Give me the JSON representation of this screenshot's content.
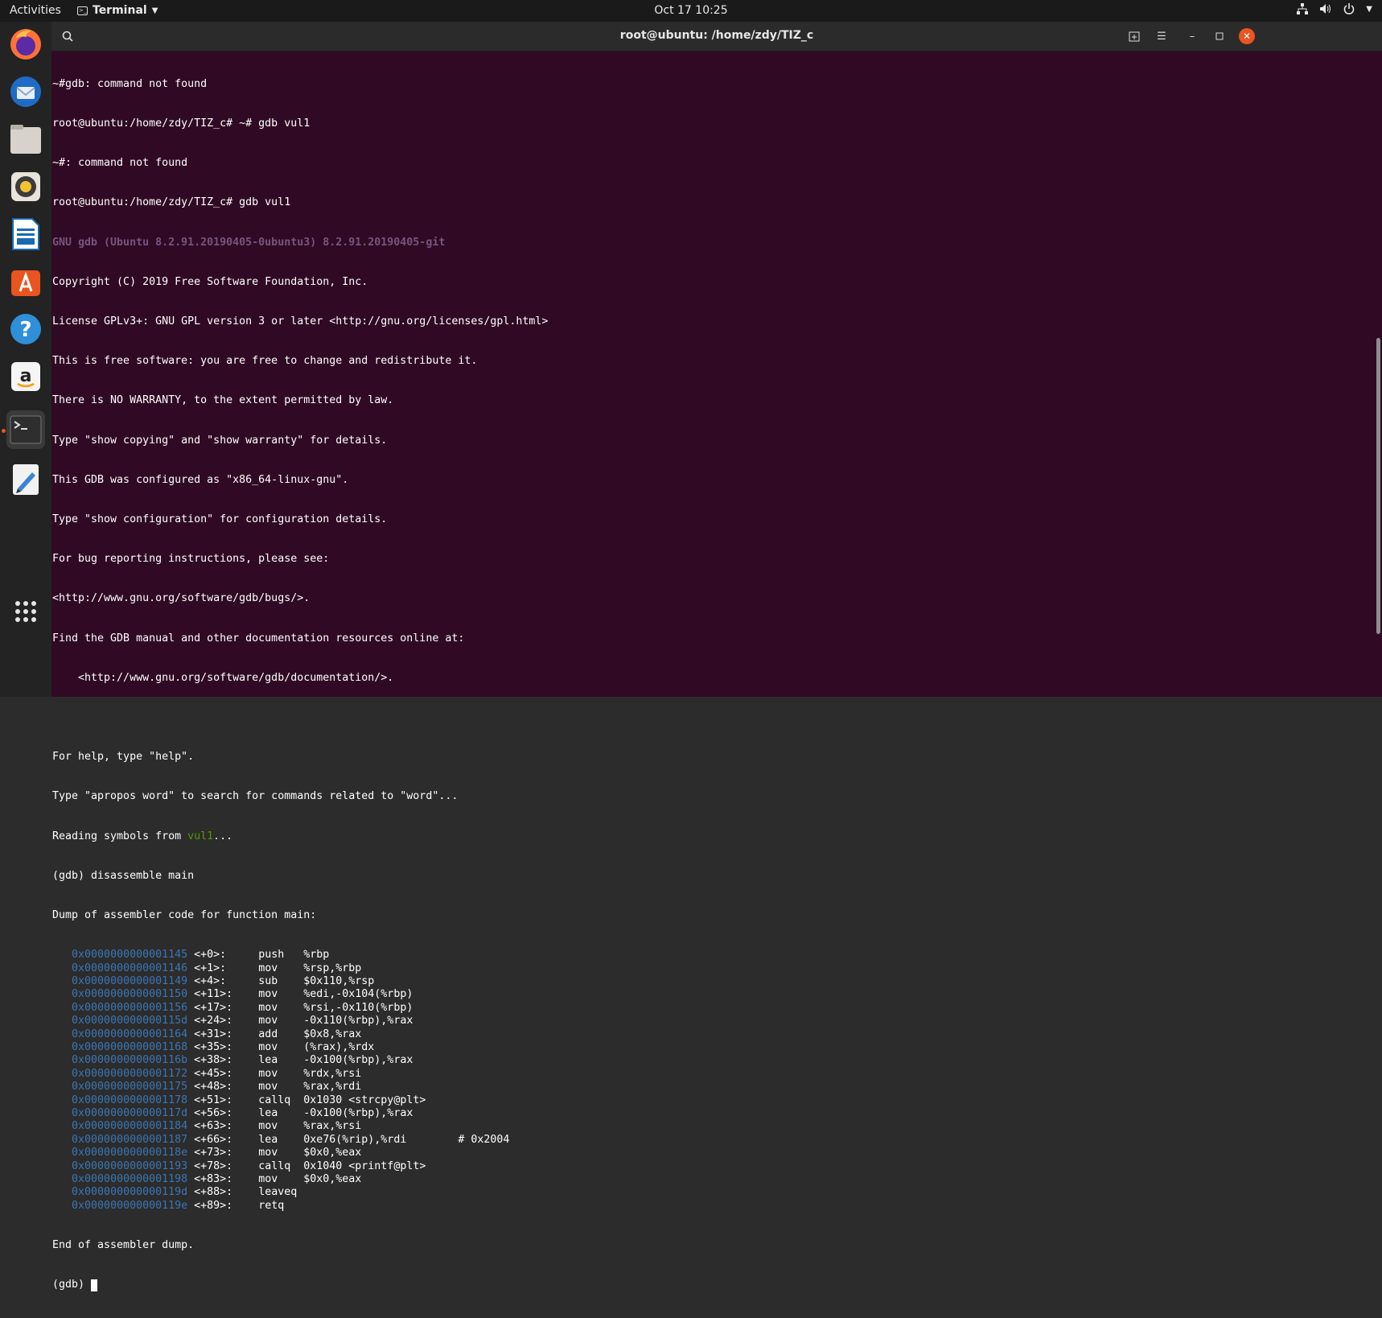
{
  "topbar": {
    "activities": "Activities",
    "app_name": "Terminal",
    "clock": "Oct 17  10:25"
  },
  "dock": {
    "items": [
      "firefox-icon",
      "thunderbird-icon",
      "files-icon",
      "rhythmbox-icon",
      "libreoffice-writer-icon",
      "software-center-icon",
      "help-icon",
      "amazon-icon",
      "terminal-icon",
      "text-editor-icon"
    ]
  },
  "window": {
    "title": "root@ubuntu: /home/zdy/TIZ_c"
  },
  "terminal": {
    "lines": [
      "~#gdb: command not found",
      "root@ubuntu:/home/zdy/TIZ_c# ~# gdb vul1",
      "~#: command not found",
      "root@ubuntu:/home/zdy/TIZ_c# gdb vul1",
      "GNU gdb (Ubuntu 8.2.91.20190405-0ubuntu3) 8.2.91.20190405-git",
      "Copyright (C) 2019 Free Software Foundation, Inc.",
      "License GPLv3+: GNU GPL version 3 or later <http://gnu.org/licenses/gpl.html>",
      "This is free software: you are free to change and redistribute it.",
      "There is NO WARRANTY, to the extent permitted by law.",
      "Type \"show copying\" and \"show warranty\" for details.",
      "This GDB was configured as \"x86_64-linux-gnu\".",
      "Type \"show configuration\" for configuration details.",
      "For bug reporting instructions, please see:",
      "<http://www.gnu.org/software/gdb/bugs/>.",
      "Find the GDB manual and other documentation resources online at:",
      "    <http://www.gnu.org/software/gdb/documentation/>.",
      "",
      "For help, type \"help\".",
      "Type \"apropos word\" to search for commands related to \"word\"...",
      "Reading symbols from ",
      "(gdb) disassemble main",
      "Dump of assembler code for function main:"
    ],
    "reading_file": "vul1",
    "reading_suffix": "...",
    "asm": [
      {
        "addr": "0x0000000000001145",
        "rest": " <+0>:     push   %rbp"
      },
      {
        "addr": "0x0000000000001146",
        "rest": " <+1>:     mov    %rsp,%rbp"
      },
      {
        "addr": "0x0000000000001149",
        "rest": " <+4>:     sub    $0x110,%rsp"
      },
      {
        "addr": "0x0000000000001150",
        "rest": " <+11>:    mov    %edi,-0x104(%rbp)"
      },
      {
        "addr": "0x0000000000001156",
        "rest": " <+17>:    mov    %rsi,-0x110(%rbp)"
      },
      {
        "addr": "0x000000000000115d",
        "rest": " <+24>:    mov    -0x110(%rbp),%rax"
      },
      {
        "addr": "0x0000000000001164",
        "rest": " <+31>:    add    $0x8,%rax"
      },
      {
        "addr": "0x0000000000001168",
        "rest": " <+35>:    mov    (%rax),%rdx"
      },
      {
        "addr": "0x000000000000116b",
        "rest": " <+38>:    lea    -0x100(%rbp),%rax"
      },
      {
        "addr": "0x0000000000001172",
        "rest": " <+45>:    mov    %rdx,%rsi"
      },
      {
        "addr": "0x0000000000001175",
        "rest": " <+48>:    mov    %rax,%rdi"
      },
      {
        "addr": "0x0000000000001178",
        "rest": " <+51>:    callq  0x1030 <strcpy@plt>"
      },
      {
        "addr": "0x000000000000117d",
        "rest": " <+56>:    lea    -0x100(%rbp),%rax"
      },
      {
        "addr": "0x0000000000001184",
        "rest": " <+63>:    mov    %rax,%rsi"
      },
      {
        "addr": "0x0000000000001187",
        "rest": " <+66>:    lea    0xe76(%rip),%rdi        # 0x2004"
      },
      {
        "addr": "0x000000000000118e",
        "rest": " <+73>:    mov    $0x0,%eax"
      },
      {
        "addr": "0x0000000000001193",
        "rest": " <+78>:    callq  0x1040 <printf@plt>"
      },
      {
        "addr": "0x0000000000001198",
        "rest": " <+83>:    mov    $0x0,%eax"
      },
      {
        "addr": "0x000000000000119d",
        "rest": " <+88>:    leaveq"
      },
      {
        "addr": "0x000000000000119e",
        "rest": " <+89>:    retq"
      }
    ],
    "end_line": "End of assembler dump.",
    "prompt": "(gdb) "
  }
}
